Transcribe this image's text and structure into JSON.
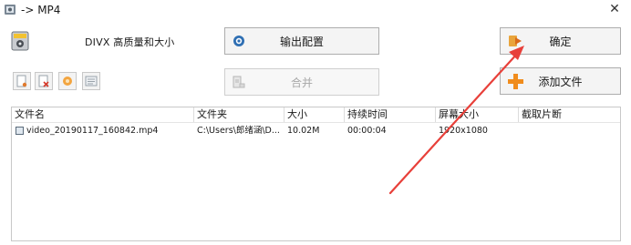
{
  "window": {
    "title": "-> MP4",
    "close_glyph": "✕"
  },
  "header": {
    "profile_label": "DIVX 高质量和大小",
    "format_icon": "video-format-icon"
  },
  "buttons": {
    "output_config": "输出配置",
    "merge": "合并",
    "ok": "确定",
    "add_file": "添加文件"
  },
  "toolbar": {
    "icons": [
      "add-item-icon",
      "remove-item-icon",
      "clear-list-icon",
      "media-info-icon"
    ]
  },
  "file_list": {
    "columns": [
      "文件名",
      "文件夹",
      "大小",
      "持续时间",
      "屏幕大小",
      "截取片断"
    ],
    "rows": [
      {
        "name": "video_20190117_160842.mp4",
        "folder": "C:\\Users\\郎绪涵\\D...",
        "size": "10.02M",
        "duration": "00:00:04",
        "resolution": "1920x1080",
        "clip": ""
      }
    ]
  },
  "annotation": {
    "color": "#e8403a",
    "points_to": "ok-button"
  }
}
